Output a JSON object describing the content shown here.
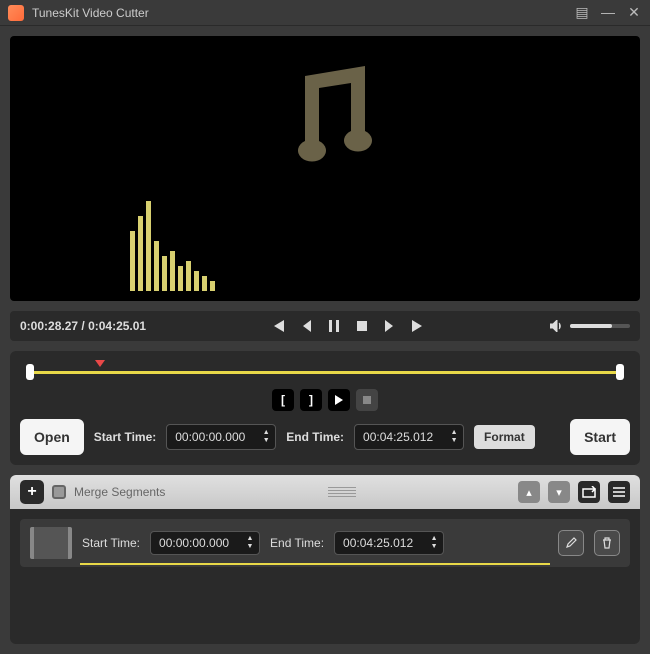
{
  "app": {
    "title": "TunesKit Video Cutter"
  },
  "playback": {
    "current_time": "0:00:28.27",
    "total_time": "0:04:25.01"
  },
  "editor": {
    "open_label": "Open",
    "start_label": "Start",
    "format_label": "Format",
    "start_time_label": "Start Time:",
    "end_time_label": "End Time:",
    "start_time_value": "00:00:00.000",
    "end_time_value": "00:04:25.012"
  },
  "segments": {
    "merge_label": "Merge Segments",
    "row": {
      "start_label": "Start Time:",
      "end_label": "End Time:",
      "start_value": "00:00:00.000",
      "end_value": "00:04:25.012"
    }
  },
  "colors": {
    "accent": "#e8d848",
    "bg_dark": "#2a2a2a"
  }
}
